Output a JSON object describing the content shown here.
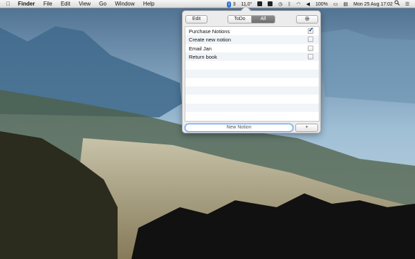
{
  "menubar": {
    "apple_icon": "apple-logo",
    "app_name": "Finder",
    "menus": [
      "File",
      "Edit",
      "View",
      "Go",
      "Window",
      "Help"
    ],
    "status": {
      "app_badge": "3",
      "temperature": "11.0°",
      "battery": "100%",
      "date_time": "Mon 25 Aug  17:02"
    }
  },
  "popover": {
    "edit_label": "Edit",
    "segment": [
      "ToDo",
      "All"
    ],
    "selected_segment": "All",
    "gear_icon": "gear-icon",
    "items": [
      {
        "label": "Purchase Notions",
        "checked": true
      },
      {
        "label": "Create new notion",
        "checked": false
      },
      {
        "label": "Email Jan",
        "checked": false
      },
      {
        "label": "Return book",
        "checked": false
      }
    ],
    "new_notion_placeholder": "New Notion",
    "add_label": "+"
  }
}
